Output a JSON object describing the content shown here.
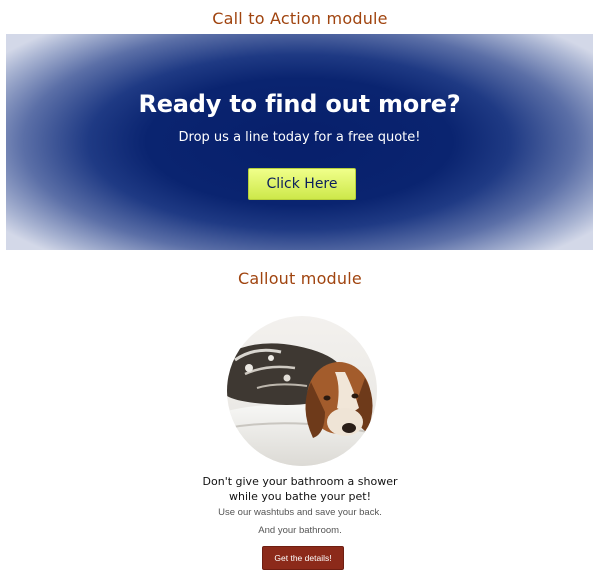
{
  "cta_module": {
    "heading": "Call to Action module",
    "title": "Ready to find out more?",
    "subtitle": "Drop us a line today for a free quote!",
    "button_label": "Click Here",
    "colors": {
      "heading": "#a0440f",
      "banner_center": "#071f6b",
      "button": "#e6f86a"
    }
  },
  "callout_module": {
    "heading": "Callout module",
    "image_icon": "dog-in-bathtub-photo",
    "headline_line1": "Don't give your bathroom a shower",
    "headline_line2": "while you bathe your pet!",
    "line1": "Use our washtubs and save your back.",
    "line2": "And your bathroom.",
    "button_label": "Get the details!",
    "colors": {
      "button": "#8c2a1a"
    }
  }
}
